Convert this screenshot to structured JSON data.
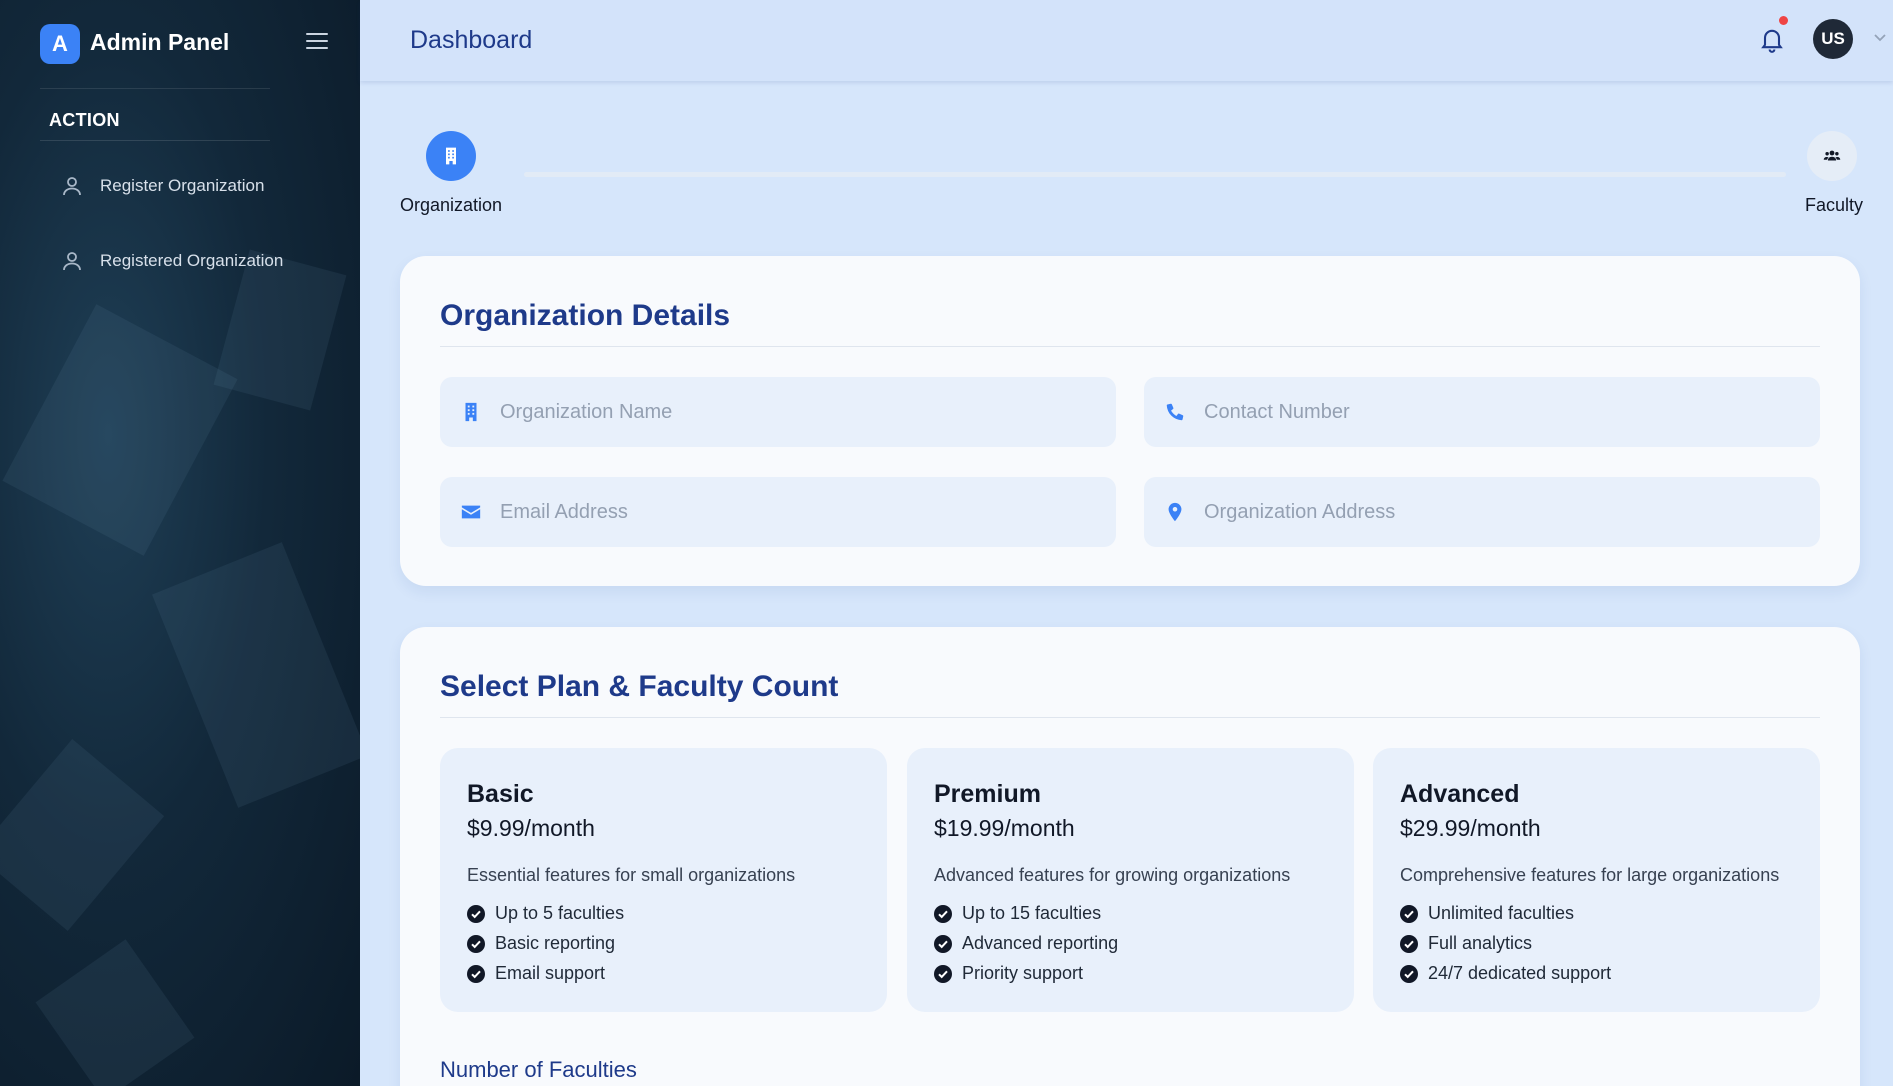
{
  "sidebar": {
    "logo_letter": "A",
    "app_title": "Admin Panel",
    "section": "ACTION",
    "items": [
      {
        "label": "Register Organization",
        "icon": "user-icon"
      },
      {
        "label": "Registered Organization",
        "icon": "user-icon"
      }
    ]
  },
  "header": {
    "title": "Dashboard",
    "avatar_initials": "US",
    "notification_dot_color": "#ef4444"
  },
  "stepper": {
    "steps": [
      {
        "label": "Organization",
        "icon": "building-icon",
        "active": true
      },
      {
        "label": "Faculty",
        "icon": "users-icon",
        "active": false
      }
    ]
  },
  "org_details": {
    "title": "Organization Details",
    "fields": {
      "name": {
        "placeholder": "Organization Name",
        "icon": "building-icon"
      },
      "contact": {
        "placeholder": "Contact Number",
        "icon": "phone-icon"
      },
      "email": {
        "placeholder": "Email Address",
        "icon": "envelope-icon"
      },
      "address": {
        "placeholder": "Organization Address",
        "icon": "location-pin-icon"
      }
    }
  },
  "plans": {
    "title": "Select Plan & Faculty Count",
    "items": [
      {
        "name": "Basic",
        "price": "$9.99/month",
        "description": "Essential features for small organizations",
        "features": [
          "Up to 5 faculties",
          "Basic reporting",
          "Email support"
        ]
      },
      {
        "name": "Premium",
        "price": "$19.99/month",
        "description": "Advanced features for growing organizations",
        "features": [
          "Up to 15 faculties",
          "Advanced reporting",
          "Priority support"
        ]
      },
      {
        "name": "Advanced",
        "price": "$29.99/month",
        "description": "Comprehensive features for large organizations",
        "features": [
          "Unlimited faculties",
          "Full analytics",
          "24/7 dedicated support"
        ]
      }
    ],
    "faculty_count_label": "Number of Faculties"
  },
  "colors": {
    "accent": "#3b82f6",
    "heading": "#1e3a8a",
    "page_bg": "#d6e6fb"
  }
}
